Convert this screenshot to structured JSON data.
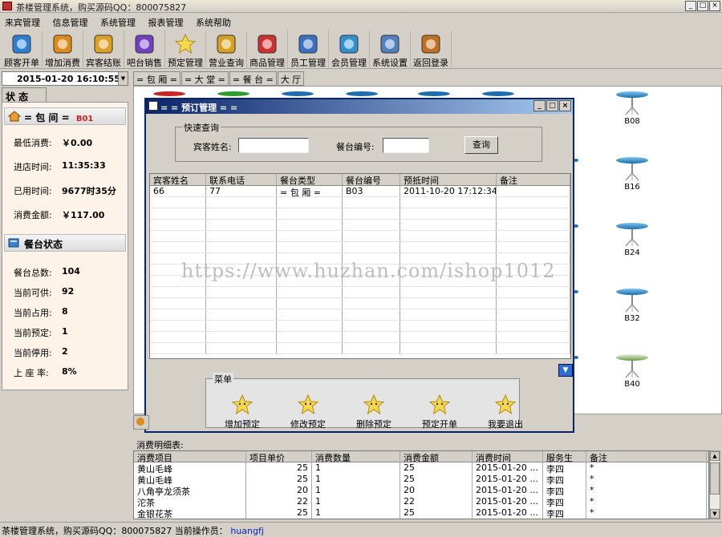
{
  "window": {
    "title": "茶楼管理系统，购买源码QQ：800075827"
  },
  "menu": [
    "来宾管理",
    "信息管理",
    "系统管理",
    "报表管理",
    "系统帮助"
  ],
  "toolbar": [
    {
      "label": "顾客开单",
      "icon": "open-order-icon",
      "color": "#2a7fd4"
    },
    {
      "label": "增加消费",
      "icon": "add-consume-icon",
      "color": "#e08a18"
    },
    {
      "label": "宾客结账",
      "icon": "checkout-icon",
      "color": "#e0a020"
    },
    {
      "label": "吧台销售",
      "icon": "bar-sale-icon",
      "color": "#7040c0"
    },
    {
      "label": "预定管理",
      "icon": "reservation-star-icon",
      "color": "#f2d030"
    },
    {
      "label": "营业查询",
      "icon": "search-icon",
      "color": "#d8a020"
    },
    {
      "label": "商品管理",
      "icon": "gear-icon",
      "color": "#d03030"
    },
    {
      "label": "员工管理",
      "icon": "staff-card-icon",
      "color": "#3a70c0"
    },
    {
      "label": "会员管理",
      "icon": "member-icon",
      "color": "#3090d0"
    },
    {
      "label": "系统设置",
      "icon": "settings-tools-icon",
      "color": "#5080c0"
    },
    {
      "label": "返回登录",
      "icon": "exit-door-icon",
      "color": "#c07020"
    }
  ],
  "left": {
    "datetime": "2015-01-20  16:10:55",
    "state_tab": "状 态",
    "room_header": {
      "prefix": "= 包 间 =",
      "code": "B01"
    },
    "room_info": [
      {
        "label": "最低消费:",
        "value": "￥0.00"
      },
      {
        "label": "进店时间:",
        "value": "11:35:33"
      },
      {
        "label": "已用时间:",
        "value": "9677时35分"
      },
      {
        "label": "消费金额:",
        "value": "￥117.00"
      }
    ],
    "table_header": "餐台状态",
    "table_info": [
      {
        "label": "餐台总数:",
        "value": "104"
      },
      {
        "label": "当前可供:",
        "value": "92"
      },
      {
        "label": "当前占用:",
        "value": "8"
      },
      {
        "label": "当前预定:",
        "value": "1"
      },
      {
        "label": "当前停用:",
        "value": "2"
      },
      {
        "label": "上 座 率:",
        "value": "8%"
      }
    ]
  },
  "tabs": [
    "= 包 厢 =",
    "= 大 堂 =",
    "= 餐 台 =",
    "大 厅"
  ],
  "seats": [
    "B08",
    "B16",
    "B24",
    "B32",
    "B40"
  ],
  "dialog": {
    "title": "= = 预订管理 = =",
    "quick_query": "快速查询",
    "guest_label": "宾客姓名:",
    "table_label": "餐台编号:",
    "query_button": "查询",
    "columns": [
      "宾客姓名",
      "联系电话",
      "餐台类型",
      "餐台编号",
      "预抵时间",
      "备注"
    ],
    "rows": [
      [
        "66",
        "77",
        "= 包 厢 =",
        "B03",
        "2011-10-20 17:12:34",
        ""
      ]
    ],
    "menu_group": "菜单",
    "menu_items": [
      "增加预定",
      "修改预定",
      "删除预定",
      "预定开单",
      "我要退出"
    ]
  },
  "watermark": "https://www.huzhan.com/ishop1012",
  "detail": {
    "label": "消费明细表:",
    "columns": [
      "消费项目",
      "项目单价",
      "消费数量",
      "消费金额",
      "消费时间",
      "服务生",
      "备注"
    ],
    "rows": [
      [
        "黄山毛峰",
        "25",
        "1",
        "25",
        "2015-01-20 ...",
        "李四",
        "*"
      ],
      [
        "黄山毛峰",
        "25",
        "1",
        "25",
        "2015-01-20 ...",
        "李四",
        "*"
      ],
      [
        "八角亭龙须茶",
        "20",
        "1",
        "20",
        "2015-01-20 ...",
        "李四",
        "*"
      ],
      [
        "沱茶",
        "22",
        "1",
        "22",
        "2015-01-20 ...",
        "李四",
        "*"
      ],
      [
        "金银花茶",
        "25",
        "1",
        "25",
        "2015-01-20 ...",
        "李四",
        "*"
      ]
    ]
  },
  "status": {
    "text": "茶楼管理系统，购买源码QQ：800075827 当前操作员：",
    "operator": "huangfj"
  }
}
